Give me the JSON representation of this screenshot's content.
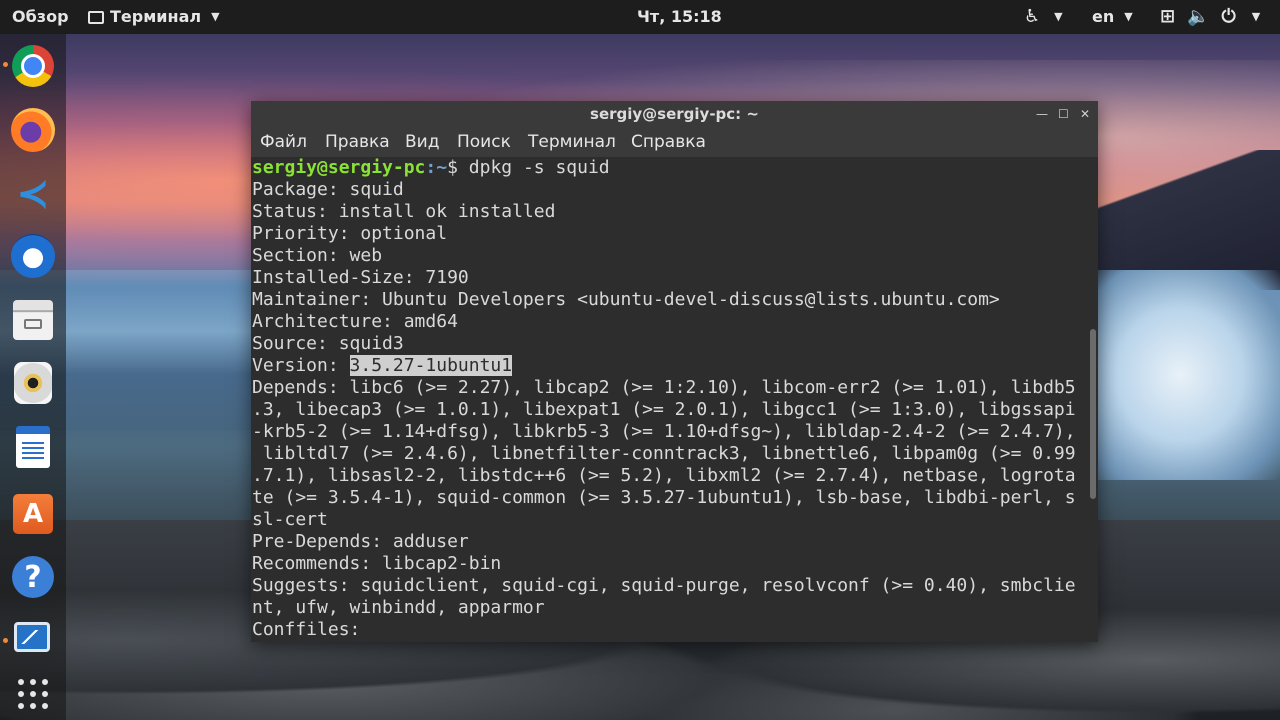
{
  "topbar": {
    "overview": "Обзор",
    "app_name": "Терминал",
    "clock": "Чт, 15:18",
    "language": "en"
  },
  "dock": {
    "apps": [
      "chrome-icon",
      "firefox-icon",
      "vscode-icon",
      "thunderbird-icon",
      "files-icon",
      "rhythmbox-icon",
      "writer-icon",
      "software-store-icon",
      "help-icon",
      "system-monitor-icon",
      "show-apps-icon"
    ],
    "running": [
      "chrome-icon",
      "system-monitor-icon"
    ]
  },
  "window": {
    "title": "sergiy@sergiy-pc: ~",
    "menu": [
      "Файл",
      "Правка",
      "Вид",
      "Поиск",
      "Терминал",
      "Справка"
    ]
  },
  "terminal": {
    "prompt_user": "sergiy@sergiy-pc",
    "prompt_path": ":~",
    "prompt_symbol": "$ ",
    "command": "dpkg -s squid",
    "version_label": "Version: ",
    "version_value": "3.5.27-1ubuntu1",
    "lines_before": [
      "Package: squid",
      "Status: install ok installed",
      "Priority: optional",
      "Section: web",
      "Installed-Size: 7190",
      "Maintainer: Ubuntu Developers <ubuntu-devel-discuss@lists.ubuntu.com>",
      "Architecture: amd64",
      "Source: squid3"
    ],
    "lines_after": [
      "Depends: libc6 (>= 2.27), libcap2 (>= 1:2.10), libcom-err2 (>= 1.01), libdb5",
      ".3, libecap3 (>= 1.0.1), libexpat1 (>= 2.0.1), libgcc1 (>= 1:3.0), libgssapi",
      "-krb5-2 (>= 1.14+dfsg), libkrb5-3 (>= 1.10+dfsg~), libldap-2.4-2 (>= 2.4.7),",
      " libltdl7 (>= 2.4.6), libnetfilter-conntrack3, libnettle6, libpam0g (>= 0.99",
      ".7.1), libsasl2-2, libstdc++6 (>= 5.2), libxml2 (>= 2.7.4), netbase, logrota",
      "te (>= 3.5.4-1), squid-common (>= 3.5.27-1ubuntu1), lsb-base, libdbi-perl, s",
      "sl-cert",
      "Pre-Depends: adduser",
      "Recommends: libcap2-bin",
      "Suggests: squidclient, squid-cgi, squid-purge, resolvconf (>= 0.40), smbclie",
      "nt, ufw, winbindd, apparmor",
      "Conffiles:"
    ]
  },
  "colors": {
    "prompt_user": "#8ae234",
    "prompt_path": "#729fcf",
    "terminal_bg": "#2d2d2d",
    "topbar_bg": "#1d1d1d",
    "accent_running": "#f08a3a"
  }
}
